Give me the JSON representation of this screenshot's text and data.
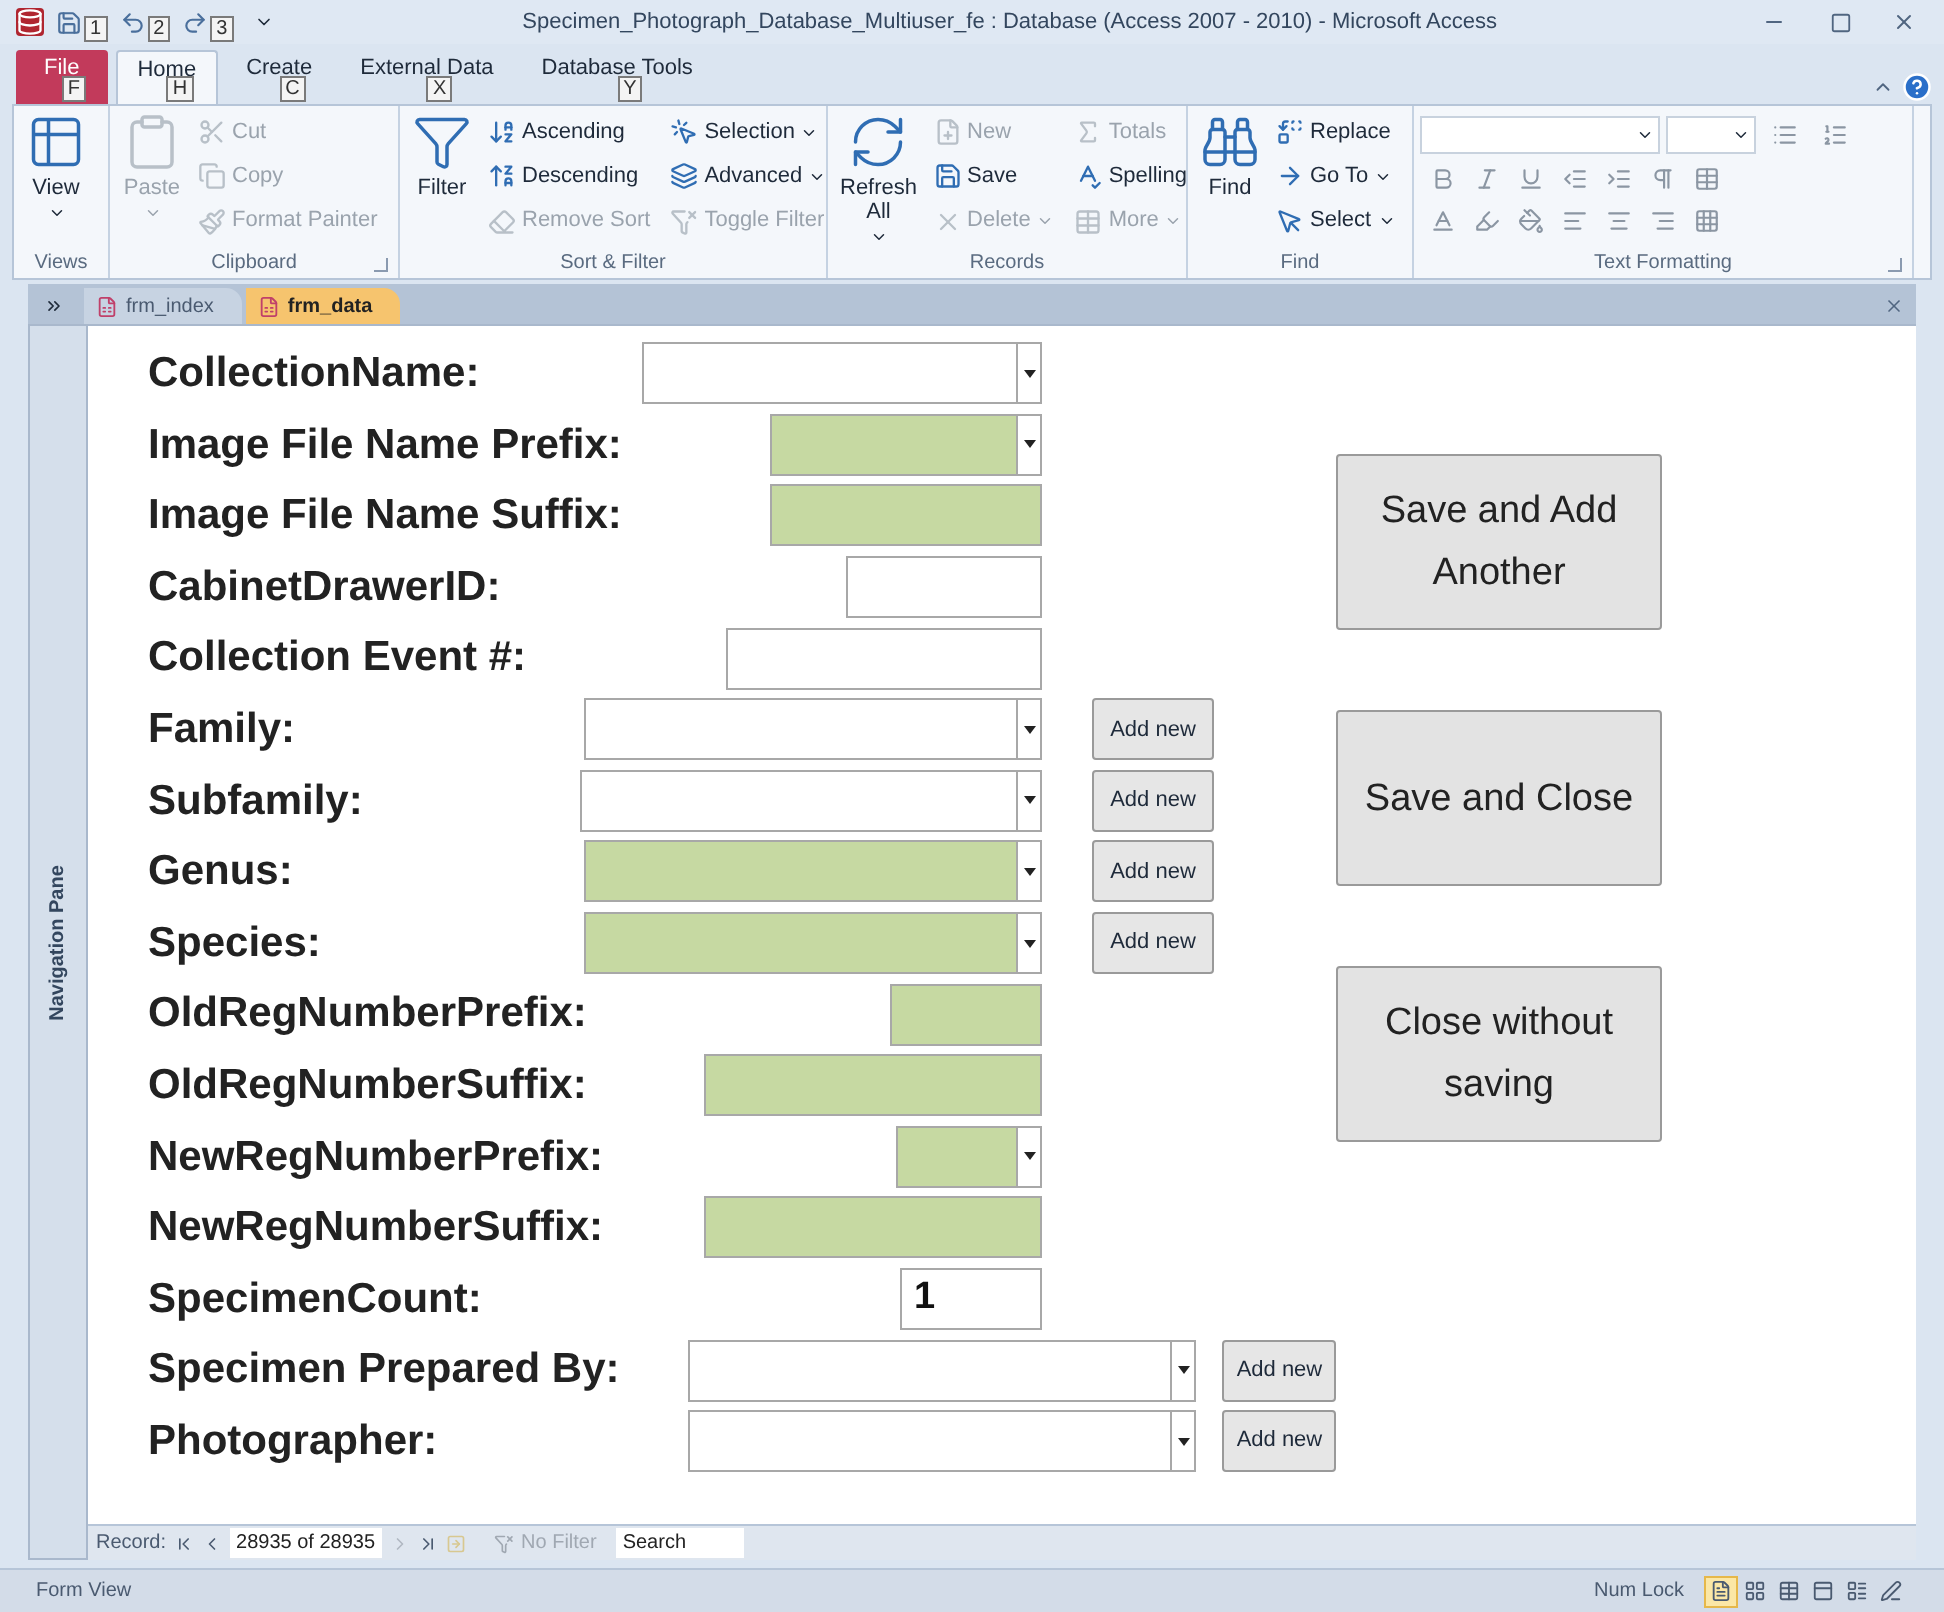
{
  "window": {
    "title": "Specimen_Photograph_Database_Multiuser_fe : Database (Access 2007 - 2010) - Microsoft Access"
  },
  "quick_access": [
    {
      "keytip": "1"
    },
    {
      "keytip": "2"
    },
    {
      "keytip": "3"
    }
  ],
  "tabs": [
    {
      "label": "File",
      "keytip": "F",
      "kind": "file",
      "selected": false
    },
    {
      "label": "Home",
      "keytip": "H",
      "kind": "tab",
      "selected": true
    },
    {
      "label": "Create",
      "keytip": "C",
      "kind": "tab",
      "selected": false
    },
    {
      "label": "External Data",
      "keytip": "X",
      "kind": "tab",
      "selected": false
    },
    {
      "label": "Database Tools",
      "keytip": "Y",
      "kind": "tab",
      "selected": false
    }
  ],
  "ribbon": {
    "groups": [
      {
        "label": "Views",
        "kind": "buttons",
        "items": [
          {
            "kind": "large",
            "label": "View",
            "menu": true,
            "disabled": false
          }
        ]
      },
      {
        "label": "Clipboard",
        "kind": "buttons",
        "launcher": true,
        "items": [
          {
            "kind": "large",
            "label": "Paste",
            "menu": true,
            "disabled": true
          },
          {
            "kind": "small",
            "label": "Cut",
            "menu": false,
            "disabled": true
          },
          {
            "kind": "small",
            "label": "Copy",
            "menu": false,
            "disabled": true
          },
          {
            "kind": "small",
            "label": "Format Painter",
            "menu": false,
            "disabled": true
          }
        ]
      },
      {
        "label": "Sort & Filter",
        "kind": "buttons",
        "launcher": false,
        "items": [
          {
            "kind": "large",
            "label": "Filter",
            "menu": false,
            "disabled": false
          },
          {
            "kind": "small",
            "label": "Ascending",
            "menu": false,
            "disabled": false
          },
          {
            "kind": "small",
            "label": "Descending",
            "menu": false,
            "disabled": false
          },
          {
            "kind": "small",
            "label": "Remove Sort",
            "menu": false,
            "disabled": true
          },
          {
            "kind": "small",
            "label": "Selection",
            "menu": true,
            "disabled": false
          },
          {
            "kind": "small",
            "label": "Advanced",
            "menu": true,
            "disabled": false
          },
          {
            "kind": "small",
            "label": "Toggle Filter",
            "menu": false,
            "disabled": true
          }
        ]
      },
      {
        "label": "Records",
        "kind": "buttons",
        "launcher": false,
        "items": [
          {
            "kind": "large",
            "label": "Refresh All",
            "menu": true,
            "disabled": false
          },
          {
            "kind": "small",
            "label": "New",
            "menu": false,
            "disabled": true
          },
          {
            "kind": "small",
            "label": "Save",
            "menu": false,
            "disabled": false
          },
          {
            "kind": "small",
            "label": "Delete",
            "menu": true,
            "disabled": true
          },
          {
            "kind": "small",
            "label": "Totals",
            "menu": false,
            "disabled": true
          },
          {
            "kind": "small",
            "label": "Spelling",
            "menu": false,
            "disabled": false
          },
          {
            "kind": "small",
            "label": "More",
            "menu": true,
            "disabled": true
          }
        ]
      },
      {
        "label": "Find",
        "kind": "buttons",
        "launcher": false,
        "items": [
          {
            "kind": "large",
            "label": "Find",
            "menu": false,
            "disabled": false
          },
          {
            "kind": "small",
            "label": "Replace",
            "menu": false,
            "disabled": false
          },
          {
            "kind": "small",
            "label": "Go To",
            "menu": true,
            "disabled": false
          },
          {
            "kind": "small",
            "label": "Select",
            "menu": true,
            "disabled": false
          }
        ]
      },
      {
        "label": "Text Formatting",
        "kind": "formatting",
        "launcher": true
      }
    ]
  },
  "documents": {
    "tabs": [
      {
        "label": "frm_index",
        "selected": false
      },
      {
        "label": "frm_data",
        "selected": true
      }
    ]
  },
  "navigation_pane": {
    "label": "Navigation Pane"
  },
  "form": {
    "fields": [
      {
        "label": "CollectionName:",
        "highlighted": false,
        "dropdown": true
      },
      {
        "label": "Image File Name Prefix:",
        "highlighted": true,
        "dropdown": true
      },
      {
        "label": "Image File Name Suffix:",
        "highlighted": true,
        "dropdown": false
      },
      {
        "label": "CabinetDrawerID:",
        "highlighted": false,
        "dropdown": false
      },
      {
        "label": "Collection Event #:",
        "highlighted": false,
        "dropdown": false
      },
      {
        "label": "Family:",
        "highlighted": false,
        "dropdown": true,
        "add_button": "Add new"
      },
      {
        "label": "Subfamily:",
        "highlighted": false,
        "dropdown": true,
        "add_button": "Add new"
      },
      {
        "label": "Genus:",
        "highlighted": true,
        "dropdown": true,
        "add_button": "Add new"
      },
      {
        "label": "Species:",
        "highlighted": true,
        "dropdown": true,
        "add_button": "Add new"
      },
      {
        "label": "OldRegNumberPrefix:",
        "highlighted": true,
        "dropdown": false
      },
      {
        "label": "OldRegNumberSuffix:",
        "highlighted": true,
        "dropdown": false
      },
      {
        "label": "NewRegNumberPrefix:",
        "highlighted": true,
        "dropdown": true
      },
      {
        "label": "NewRegNumberSuffix:",
        "highlighted": true,
        "dropdown": false
      },
      {
        "label": "SpecimenCount:",
        "highlighted": false,
        "dropdown": false,
        "value": "1"
      },
      {
        "label": "Specimen Prepared By:",
        "highlighted": false,
        "dropdown": true,
        "add_button": "Add new"
      },
      {
        "label": "Photographer:",
        "highlighted": false,
        "dropdown": true,
        "add_button": "Add new"
      }
    ],
    "buttons": [
      "Save and Add Another",
      "Save and Close",
      "Close without saving"
    ]
  },
  "record_navigator": {
    "label": "Record:",
    "position": "28935 of 28935",
    "filter": "No Filter",
    "search": {
      "placeholder": "Search"
    }
  },
  "status_bar": {
    "mode": "Form View",
    "num_lock": "Num Lock",
    "view_buttons": [
      {
        "selected": true
      },
      {
        "selected": false
      },
      {
        "selected": false
      },
      {
        "selected": false
      },
      {
        "selected": false
      },
      {
        "selected": false
      }
    ]
  }
}
